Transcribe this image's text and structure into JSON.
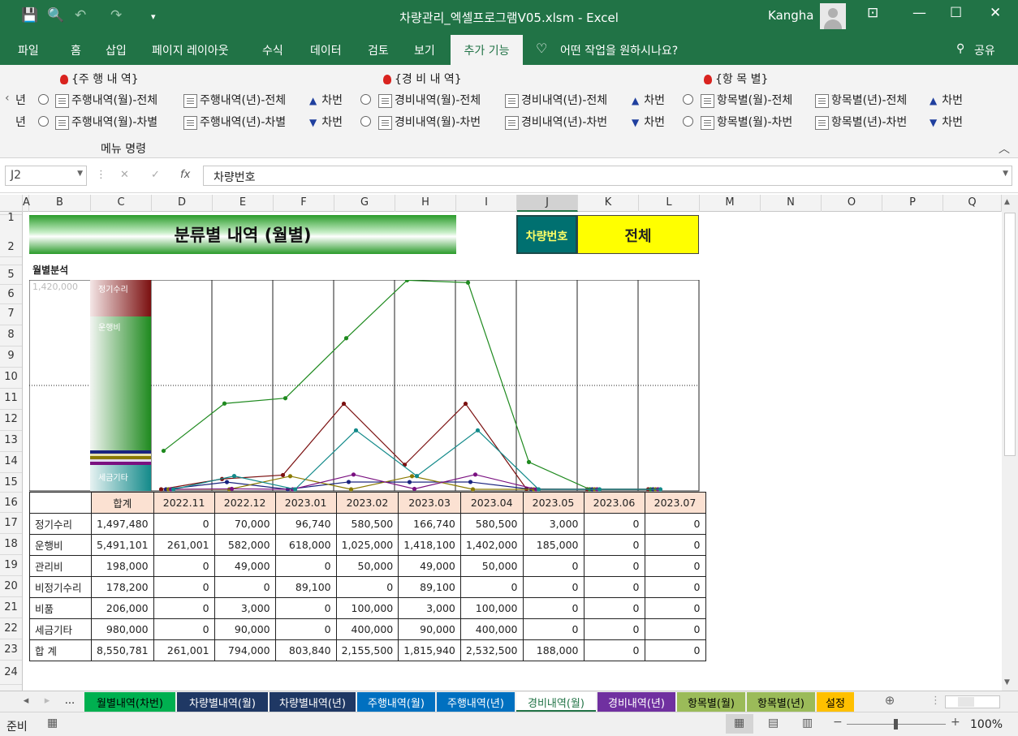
{
  "window": {
    "title": "차량관리_엑셀프로그램V05.xlsm  -  Excel",
    "user": "Kangha"
  },
  "tabs": [
    "파일",
    "홈",
    "삽입",
    "페이지 레이아웃",
    "수식",
    "데이터",
    "검토",
    "보기"
  ],
  "active_tab": "추가 기능",
  "tell_me": "어떤 작업을 원하시나요?",
  "share": "공유",
  "ribbon": {
    "groups": [
      {
        "header": "{주 행 내 역}",
        "row1": "주행내역(월)-전체",
        "row2": "주행내역(월)-차별",
        "row1b": "주행내역(년)-전체",
        "row2b": "주행내역(년)-차별"
      },
      {
        "header": "{경 비 내 역}",
        "row1": "경비내역(월)-전체",
        "row2": "경비내역(월)-차번",
        "row1b": "경비내역(년)-전체",
        "row2b": "경비내역(년)-차번"
      },
      {
        "header": "{항 목 별}",
        "row1": "항목별(월)-전체",
        "row2": "항목별(월)-차번",
        "row1b": "항목별(년)-전체",
        "row2b": "항목별(년)-차번"
      }
    ],
    "partial": "년",
    "car_num_up": "차번",
    "car_num_down": "차번",
    "footer": "메뉴 명령"
  },
  "formula": {
    "namebox": "J2",
    "fx_label": "fx",
    "content": "차량번호"
  },
  "columns": [
    "A",
    "B",
    "C",
    "D",
    "E",
    "F",
    "G",
    "H",
    "I",
    "J",
    "K",
    "L",
    "M",
    "N",
    "O",
    "P",
    "Q"
  ],
  "rows": [
    "1",
    "2",
    "5",
    "6",
    "7",
    "8",
    "9",
    "10",
    "11",
    "12",
    "13",
    "14",
    "15",
    "16",
    "17",
    "18",
    "19",
    "20",
    "21",
    "22",
    "23",
    "24"
  ],
  "sheet": {
    "banner": "분류별 내역 (월별)",
    "car_label": "차량번호",
    "car_value": "전체",
    "section_title": "월별분석",
    "y_max_label": "1,420,000",
    "legend_labels": [
      "정기수리",
      "운행비",
      "세금기타"
    ]
  },
  "table": {
    "header": [
      "",
      "합계",
      "2022.11",
      "2022.12",
      "2023.01",
      "2023.02",
      "2023.03",
      "2023.04",
      "2023.05",
      "2023.06",
      "2023.07"
    ],
    "rows": [
      [
        "정기수리",
        "1,497,480",
        "0",
        "70,000",
        "96,740",
        "580,500",
        "166,740",
        "580,500",
        "3,000",
        "0",
        "0"
      ],
      [
        "운행비",
        "5,491,101",
        "261,001",
        "582,000",
        "618,000",
        "1,025,000",
        "1,418,100",
        "1,402,000",
        "185,000",
        "0",
        "0"
      ],
      [
        "관리비",
        "198,000",
        "0",
        "49,000",
        "0",
        "50,000",
        "49,000",
        "50,000",
        "0",
        "0",
        "0"
      ],
      [
        "비정기수리",
        "178,200",
        "0",
        "0",
        "89,100",
        "0",
        "89,100",
        "0",
        "0",
        "0",
        "0"
      ],
      [
        "비품",
        "206,000",
        "0",
        "3,000",
        "0",
        "100,000",
        "3,000",
        "100,000",
        "0",
        "0",
        "0"
      ],
      [
        "세금기타",
        "980,000",
        "0",
        "90,000",
        "0",
        "400,000",
        "90,000",
        "400,000",
        "0",
        "0",
        "0"
      ],
      [
        "합 계",
        "8,550,781",
        "261,001",
        "794,000",
        "803,840",
        "2,155,500",
        "1,815,940",
        "2,532,500",
        "188,000",
        "0",
        "0"
      ]
    ]
  },
  "chart_data": {
    "type": "line",
    "categories": [
      "2022.11",
      "2022.12",
      "2023.01",
      "2023.02",
      "2023.03",
      "2023.04",
      "2023.05",
      "2023.06",
      "2023.07"
    ],
    "ylim": [
      0,
      1420000
    ],
    "series": [
      {
        "name": "정기수리",
        "color": "#7b1010",
        "values": [
          0,
          70000,
          96740,
          580500,
          166740,
          580500,
          3000,
          0,
          0
        ]
      },
      {
        "name": "운행비",
        "color": "#1f8a1f",
        "values": [
          261001,
          582000,
          618000,
          1025000,
          1418100,
          1402000,
          185000,
          0,
          0
        ]
      },
      {
        "name": "관리비",
        "color": "#1a237e",
        "values": [
          0,
          49000,
          0,
          50000,
          49000,
          50000,
          0,
          0,
          0
        ]
      },
      {
        "name": "비정기수리",
        "color": "#8a7a00",
        "values": [
          0,
          0,
          89100,
          0,
          89100,
          0,
          0,
          0,
          0
        ]
      },
      {
        "name": "비품",
        "color": "#7a1080",
        "values": [
          0,
          3000,
          0,
          100000,
          3000,
          100000,
          0,
          0,
          0
        ]
      },
      {
        "name": "세금기타",
        "color": "#138a8a",
        "values": [
          0,
          90000,
          0,
          400000,
          90000,
          400000,
          0,
          0,
          0
        ]
      }
    ]
  },
  "sheet_tabs": [
    {
      "label": "월별내역(차번)",
      "bg": "#00b050",
      "fg": "#000"
    },
    {
      "label": "차량별내역(월)",
      "bg": "#1f3864",
      "fg": "#fff"
    },
    {
      "label": "차량별내역(년)",
      "bg": "#1f3864",
      "fg": "#fff"
    },
    {
      "label": "주행내역(월)",
      "bg": "#0070c0",
      "fg": "#fff"
    },
    {
      "label": "주행내역(년)",
      "bg": "#0070c0",
      "fg": "#fff"
    },
    {
      "label": "경비내역(월)",
      "bg": "#ffffff",
      "fg": "#217346"
    },
    {
      "label": "경비내역(년)",
      "bg": "#7030a0",
      "fg": "#fff"
    },
    {
      "label": "항목별(월)",
      "bg": "#9bbb59",
      "fg": "#000"
    },
    {
      "label": "항목별(년)",
      "bg": "#9bbb59",
      "fg": "#000"
    },
    {
      "label": "설정",
      "bg": "#ffc000",
      "fg": "#000"
    }
  ],
  "status": {
    "ready": "준비",
    "zoom": "100%"
  }
}
